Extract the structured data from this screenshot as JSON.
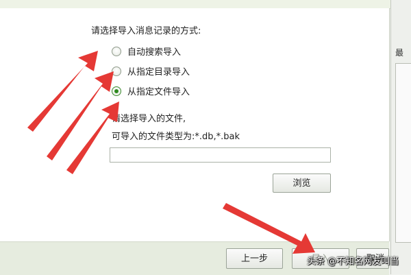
{
  "dialog": {
    "section_title": "请选择导入消息记录的方式:",
    "options": [
      {
        "label": "自动搜索导入",
        "checked": false
      },
      {
        "label": "从指定目录导入",
        "checked": false
      },
      {
        "label": "从指定文件导入",
        "checked": true
      }
    ],
    "file_prompt": "请选择导入的文件,",
    "file_types": "可导入的文件类型为:*.db,*.bak",
    "file_path_value": "",
    "browse_label": "浏览"
  },
  "footer": {
    "prev_label": "上一步",
    "import_label": "导入",
    "cancel_label": "取消"
  },
  "side_panel": {
    "glyph": "最"
  },
  "watermark": "头条 @不知名网友叫当",
  "colors": {
    "accent_green": "#2e8b1f",
    "arrow_red": "#e53935",
    "footer_bg": "#e6ecdf"
  }
}
